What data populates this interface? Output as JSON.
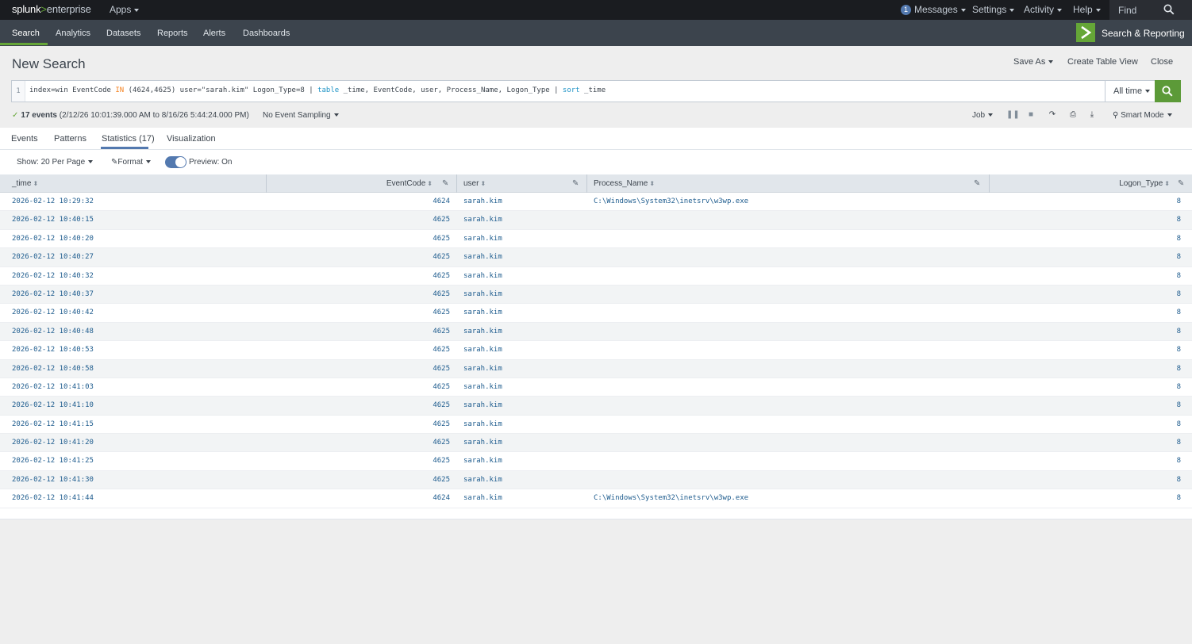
{
  "topbar": {
    "logo_main": "splunk",
    "logo_sep": ">",
    "logo_sub": "enterprise",
    "apps": "Apps",
    "messages_count": "1",
    "messages": "Messages",
    "settings": "Settings",
    "activity": "Activity",
    "help": "Help",
    "find": "Find"
  },
  "appbar": {
    "items": [
      "Search",
      "Analytics",
      "Datasets",
      "Reports",
      "Alerts",
      "Dashboards"
    ],
    "app_title": "Search & Reporting"
  },
  "header": {
    "title": "New Search",
    "save_as": "Save As",
    "create_table_view": "Create Table View",
    "close": "Close"
  },
  "search": {
    "line_number": "1",
    "query_p1": "index=win EventCode ",
    "query_kw": "IN",
    "query_p2": " (4624,4625) user=\"sarah.kim\" Logon_Type=8 | ",
    "query_cmd1": "table",
    "query_p3": " _time, EventCode, user, Process_Name, Logon_Type | ",
    "query_cmd2": "sort",
    "query_p4": " _time",
    "time_range": "All time"
  },
  "status": {
    "events": "17 events",
    "range": "(2/12/26 10:01:39.000 AM to 8/16/26 5:44:24.000 PM)",
    "sampling": "No Event Sampling",
    "job": "Job",
    "mode": "Smart Mode"
  },
  "tabs": [
    "Events",
    "Patterns",
    "Statistics (17)",
    "Visualization"
  ],
  "toolbar": {
    "per_page": "Show: 20 Per Page",
    "format": "Format",
    "preview": "Preview: On"
  },
  "table": {
    "columns": [
      "_time",
      "EventCode",
      "user",
      "Process_Name",
      "Logon_Type"
    ],
    "rows": [
      [
        "2026-02-12 10:29:32",
        "4624",
        "sarah.kim",
        "C:\\Windows\\System32\\inetsrv\\w3wp.exe",
        "8"
      ],
      [
        "2026-02-12 10:40:15",
        "4625",
        "sarah.kim",
        "",
        "8"
      ],
      [
        "2026-02-12 10:40:20",
        "4625",
        "sarah.kim",
        "",
        "8"
      ],
      [
        "2026-02-12 10:40:27",
        "4625",
        "sarah.kim",
        "",
        "8"
      ],
      [
        "2026-02-12 10:40:32",
        "4625",
        "sarah.kim",
        "",
        "8"
      ],
      [
        "2026-02-12 10:40:37",
        "4625",
        "sarah.kim",
        "",
        "8"
      ],
      [
        "2026-02-12 10:40:42",
        "4625",
        "sarah.kim",
        "",
        "8"
      ],
      [
        "2026-02-12 10:40:48",
        "4625",
        "sarah.kim",
        "",
        "8"
      ],
      [
        "2026-02-12 10:40:53",
        "4625",
        "sarah.kim",
        "",
        "8"
      ],
      [
        "2026-02-12 10:40:58",
        "4625",
        "sarah.kim",
        "",
        "8"
      ],
      [
        "2026-02-12 10:41:03",
        "4625",
        "sarah.kim",
        "",
        "8"
      ],
      [
        "2026-02-12 10:41:10",
        "4625",
        "sarah.kim",
        "",
        "8"
      ],
      [
        "2026-02-12 10:41:15",
        "4625",
        "sarah.kim",
        "",
        "8"
      ],
      [
        "2026-02-12 10:41:20",
        "4625",
        "sarah.kim",
        "",
        "8"
      ],
      [
        "2026-02-12 10:41:25",
        "4625",
        "sarah.kim",
        "",
        "8"
      ],
      [
        "2026-02-12 10:41:30",
        "4625",
        "sarah.kim",
        "",
        "8"
      ],
      [
        "2026-02-12 10:41:44",
        "4624",
        "sarah.kim",
        "C:\\Windows\\System32\\inetsrv\\w3wp.exe",
        "8"
      ]
    ]
  },
  "colors": {
    "accent_green": "#65a637",
    "accent_blue": "#5379af",
    "link_blue": "#1e5c8e"
  }
}
